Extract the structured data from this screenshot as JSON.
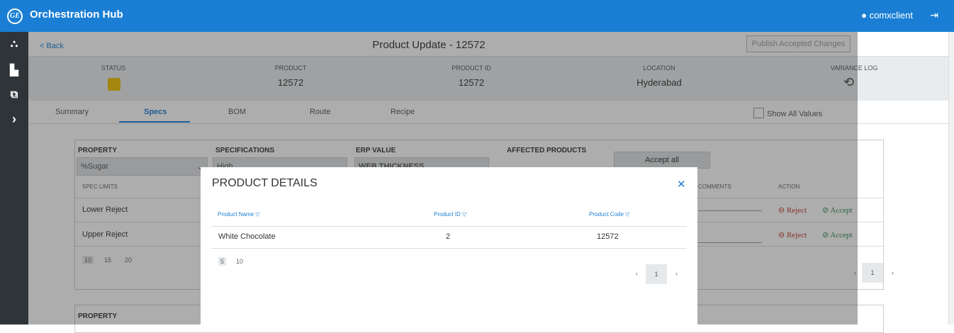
{
  "app": {
    "title": "Orchestration Hub",
    "logo": "GE",
    "user": "comxclient"
  },
  "page": {
    "back_label": "< Back",
    "title": "Product Update - 12572",
    "publish_label": "Publish Accepted Changes"
  },
  "info": {
    "status_label": "STATUS",
    "product_label": "PRODUCT",
    "product_value": "12572",
    "product_id_label": "PRODUCT ID",
    "product_id_value": "12572",
    "location_label": "LOCATION",
    "location_value": "Hyderabad",
    "variance_label": "VARIANCE LOG"
  },
  "tabs": [
    "Summary",
    "Specs",
    "BOM",
    "Route",
    "Recipe"
  ],
  "show_all_label": "Show All Values",
  "spec": {
    "property_header": "PROPERTY",
    "property_value": "%Sugar",
    "spec_header": "SPECIFICATIONS",
    "spec_value": "High",
    "erp_header": "ERP VALUE",
    "erp_value": "WEB THICKNESS",
    "affected_header": "AFFECTED PRODUCTS",
    "accept_all": "Accept all",
    "spec_limits": "SPEC LIMITS",
    "comments": "COMMENTS",
    "action": "ACTION",
    "rows": [
      "Lower Reject",
      "Upper Reject"
    ],
    "reject": "Reject",
    "accept": "Accept",
    "page_sizes": [
      "10",
      "15",
      "20"
    ],
    "page": "1"
  },
  "card2_property": "PROPERTY",
  "modal": {
    "title": "PRODUCT DETAILS",
    "col_name": "Product Name",
    "col_id": "Product ID",
    "col_code": "Product Code",
    "row": {
      "name": "White Chocolate",
      "id": "2",
      "code": "12572"
    },
    "page_sizes": [
      "5",
      "10"
    ],
    "page": "1"
  }
}
